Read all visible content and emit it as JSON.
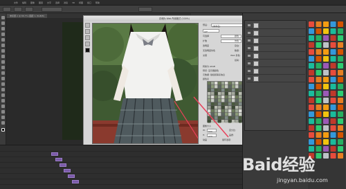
{
  "app": {
    "menu_items": [
      "文件",
      "编辑",
      "图像",
      "图层",
      "文字",
      "选择",
      "滤镜",
      "3D",
      "视图",
      "窗口",
      "帮助"
    ],
    "doc_tab": "未标题-1 @ 66.7% (图层 1, RGB/8)"
  },
  "dialog": {
    "title": "存储为 Web 所用格式 (100%)",
    "preset_label": "预设:",
    "preset_value": "[未命名]",
    "format_value": "GIF",
    "rows": [
      {
        "label": "可选择",
        "value": "颜色:",
        "value2": "256"
      },
      {
        "label": "扩散",
        "value": "仿色:",
        "value2": "100%"
      },
      {
        "label": "透明度",
        "value": "杂边:",
        "value2": ""
      },
      {
        "label": "无透明度仿色",
        "value": "数量:",
        "value2": ""
      },
      {
        "label": "交错",
        "value": "Web 靠色:",
        "value2": "0%"
      },
      {
        "label": "",
        "value": "损耗:",
        "value2": "0"
      }
    ],
    "checkbox1": "转换为 sRGB",
    "checkbox2": "预览: 显示器颜色",
    "metadata_label": "元数据: 版权和联系信息",
    "color_table_label": "颜色表",
    "image_size_label": "图像大小",
    "w_label": "W:",
    "w_value": "500",
    "h_label": "H:",
    "h_value": "273",
    "percent_label": "百分比:",
    "percent_value": "100",
    "quality_label": "品质:",
    "quality_value": "两次立方",
    "anim_label": "动画",
    "loop_label": "循环选项:",
    "loop_value": "永远",
    "frame_counter": "1/8",
    "preview_format": "GIF",
    "preview_size": "2.146M",
    "preview_time": "397 秒 @ 56.6 Kbps",
    "zoom_value": "100%",
    "rgb_label": "R: --  G: --  B: --",
    "alpha_label": "Alpha: --",
    "hex_label": "十六进制: --",
    "index_label": "索引: --",
    "preview_button": "预览...",
    "save_button": "存储...",
    "cancel_button": "取消",
    "done_button": "完成"
  },
  "watermark": {
    "brand": "Baid经验",
    "url": "jingyan.baidu.com"
  }
}
